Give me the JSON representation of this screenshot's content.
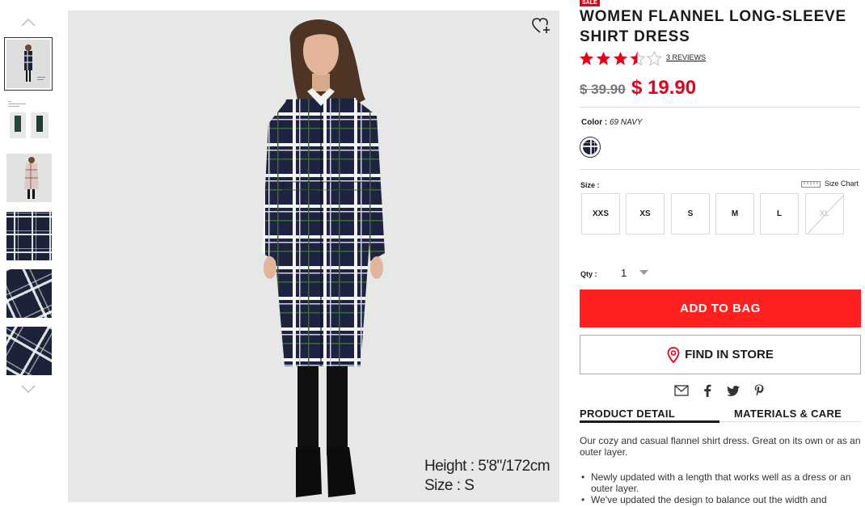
{
  "thumbnails": {
    "count": 6,
    "selected_index": 0,
    "thumb2_text": "Women Flannel Long-Sleeve Shirt Dress"
  },
  "main_image": {
    "caption_height": "Height : 5'8\"/172cm",
    "caption_size": "Size : S"
  },
  "product": {
    "badge": "SALE",
    "title": "WOMEN FLANNEL LONG-SLEEVE SHIRT DRESS",
    "rating": 3.5,
    "rating_max": 5,
    "reviews_label": "3 REVIEWS",
    "old_price": "$ 39.90",
    "new_price": "$ 19.90",
    "price_color": "#e3001b"
  },
  "color": {
    "label": "Color :",
    "value": "69 NAVY"
  },
  "size": {
    "label": "Size :",
    "chart_label": "Size Chart",
    "options": [
      "XXS",
      "XS",
      "S",
      "M",
      "L",
      "XL"
    ],
    "disabled": [
      "XL"
    ]
  },
  "qty": {
    "label": "Qty :",
    "value": "1"
  },
  "actions": {
    "add_to_bag": "ADD TO BAG",
    "find_in_store": "FIND IN STORE"
  },
  "share_icons": [
    "mail-icon",
    "facebook-icon",
    "twitter-icon",
    "pinterest-icon"
  ],
  "tabs": [
    "PRODUCT DETAIL",
    "MATERIALS & CARE"
  ],
  "detail": {
    "description": "Our cozy and casual flannel shirt dress. Great on its own or as an outer layer.",
    "bullets": [
      "Newly updated with a length that works well as a dress or an outer layer.",
      "We've updated the design to balance out the width and"
    ]
  }
}
